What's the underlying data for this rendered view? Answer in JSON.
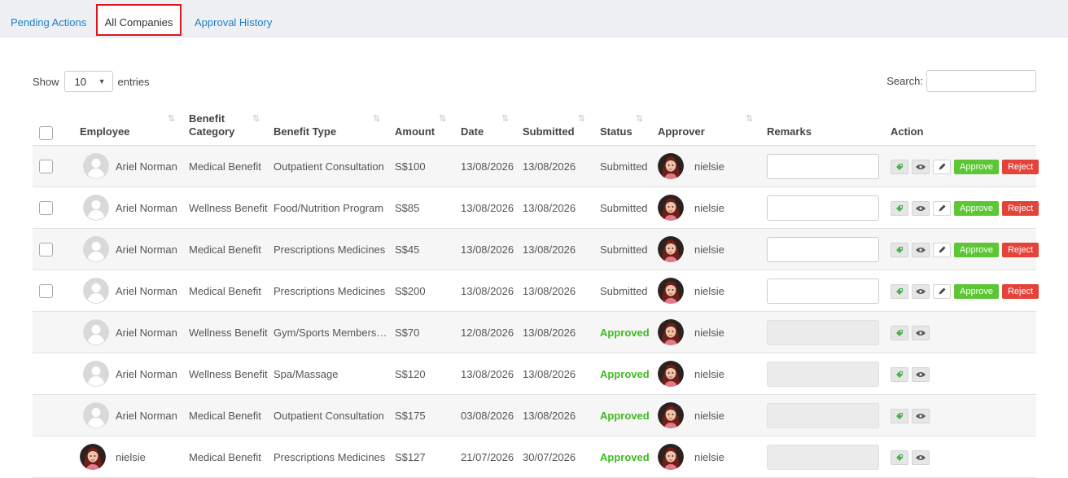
{
  "tabs": [
    {
      "label": "Pending Actions",
      "active": false
    },
    {
      "label": "All Companies",
      "active": true
    },
    {
      "label": "Approval History",
      "active": false
    }
  ],
  "length_control": {
    "show_label": "Show",
    "value": "10",
    "entries_label": "entries"
  },
  "search": {
    "label": "Search:",
    "value": ""
  },
  "table": {
    "headers": [
      "Employee",
      "Benefit Category",
      "Benefit Type",
      "Amount",
      "Date",
      "Submitted",
      "Status",
      "Approver",
      "Remarks",
      "Action"
    ],
    "rows": [
      {
        "employee": "Ariel Norman",
        "avatar": "placeholder",
        "category": "Medical Benefit",
        "type": "Outpatient Consultation",
        "amount": "S$100",
        "date": "13/08/2026",
        "submitted": "13/08/2026",
        "status": "Submitted",
        "approver": "nielsie",
        "editable": true
      },
      {
        "employee": "Ariel Norman",
        "avatar": "placeholder",
        "category": "Wellness Benefit",
        "type": "Food/Nutrition Program",
        "amount": "S$85",
        "date": "13/08/2026",
        "submitted": "13/08/2026",
        "status": "Submitted",
        "approver": "nielsie",
        "editable": true
      },
      {
        "employee": "Ariel Norman",
        "avatar": "placeholder",
        "category": "Medical Benefit",
        "type": "Prescriptions Medicines",
        "amount": "S$45",
        "date": "13/08/2026",
        "submitted": "13/08/2026",
        "status": "Submitted",
        "approver": "nielsie",
        "editable": true
      },
      {
        "employee": "Ariel Norman",
        "avatar": "placeholder",
        "category": "Medical Benefit",
        "type": "Prescriptions Medicines",
        "amount": "S$200",
        "date": "13/08/2026",
        "submitted": "13/08/2026",
        "status": "Submitted",
        "approver": "nielsie",
        "editable": true
      },
      {
        "employee": "Ariel Norman",
        "avatar": "placeholder",
        "category": "Wellness Benefit",
        "type": "Gym/Sports Members…",
        "amount": "S$70",
        "date": "12/08/2026",
        "submitted": "13/08/2026",
        "status": "Approved",
        "approver": "nielsie",
        "editable": false
      },
      {
        "employee": "Ariel Norman",
        "avatar": "placeholder",
        "category": "Wellness Benefit",
        "type": "Spa/Massage",
        "amount": "S$120",
        "date": "13/08/2026",
        "submitted": "13/08/2026",
        "status": "Approved",
        "approver": "nielsie",
        "editable": false
      },
      {
        "employee": "Ariel Norman",
        "avatar": "placeholder",
        "category": "Medical Benefit",
        "type": "Outpatient Consultation",
        "amount": "S$175",
        "date": "03/08/2026",
        "submitted": "13/08/2026",
        "status": "Approved",
        "approver": "nielsie",
        "editable": false
      },
      {
        "employee": "nielsie",
        "avatar": "photo",
        "category": "Medical Benefit",
        "type": "Prescriptions Medicines",
        "amount": "S$127",
        "date": "21/07/2026",
        "submitted": "30/07/2026",
        "status": "Approved",
        "approver": "nielsie",
        "editable": false
      }
    ]
  },
  "actions": {
    "approve_label": "Approve",
    "reject_label": "Reject"
  },
  "colors": {
    "tab_link": "#1d7fc4",
    "active_tab_outline": "#e0161c",
    "approve": "#5cc634",
    "reject": "#e44339",
    "approved_text": "#3bbb1f"
  }
}
